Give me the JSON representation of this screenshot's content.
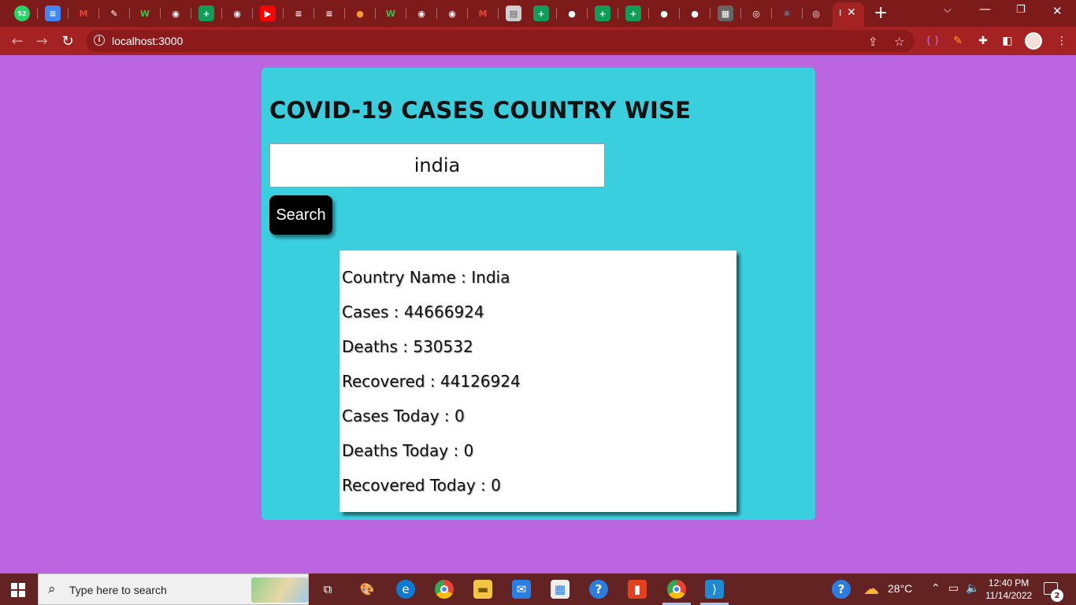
{
  "browser": {
    "url": "localhost:3000",
    "active_tab_label": "I",
    "pinned_tab_icons": [
      "whatsapp-icon",
      "docs-icon",
      "gmail-icon",
      "pen-icon",
      "w-icon",
      "globe-icon",
      "sheets-icon",
      "globe-icon",
      "youtube-icon",
      "bars-icon",
      "bars-icon",
      "fire-icon",
      "w-icon",
      "globe-icon",
      "globe-icon",
      "gmail-icon",
      "doc-icon",
      "sheets-icon",
      "github-icon",
      "sheets-icon",
      "sheets-icon",
      "github-icon",
      "github-icon",
      "chip-icon",
      "chrome-icon",
      "react-icon",
      "chrome-icon"
    ],
    "badge_count": "52",
    "new_tab": "+",
    "minimize": "—",
    "restore": "❐",
    "close": "✕"
  },
  "page": {
    "title": "COVID-19 CASES COUNTRY WISE",
    "search_value": "india",
    "search_button": "Search",
    "results": [
      "Country Name : India",
      "Cases : 44666924",
      "Deaths : 530532",
      "Recovered : 44126924",
      "Cases Today : 0",
      "Deaths Today : 0",
      "Recovered Today : 0"
    ],
    "colors": {
      "background": "#bb65e0",
      "card": "#3acfde",
      "button": "#000000"
    }
  },
  "taskbar": {
    "search_placeholder": "Type here to search",
    "weather": "28°C",
    "time": "12:40 PM",
    "date": "11/14/2022",
    "notification_count": "2",
    "apps": [
      "task-view-icon",
      "paint-icon",
      "edge-icon",
      "chrome-icon",
      "file-explorer-icon",
      "mail-icon",
      "store-icon",
      "help-icon",
      "office-icon",
      "chrome-icon",
      "vscode-icon"
    ]
  }
}
